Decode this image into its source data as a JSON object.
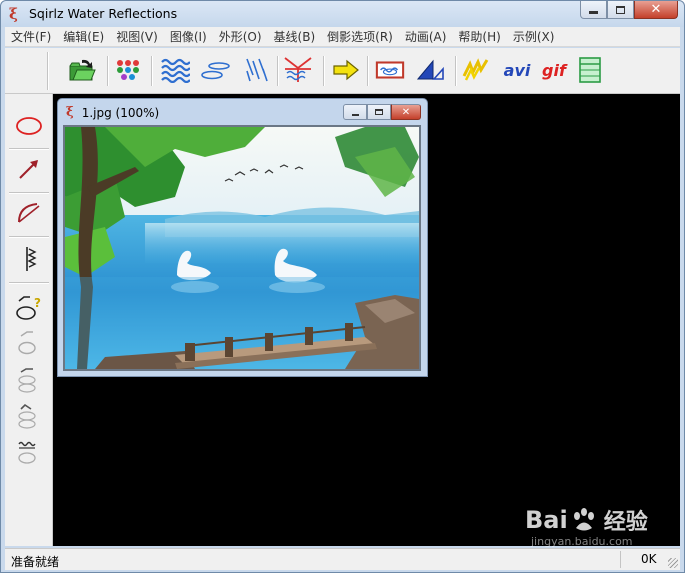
{
  "app": {
    "title": "Sqirlz Water Reflections",
    "icon_glyph": "ξ",
    "close_glyph": "✕"
  },
  "menu": [
    {
      "label": "文件(F)"
    },
    {
      "label": "编辑(E)"
    },
    {
      "label": "视图(V)"
    },
    {
      "label": "图像(I)"
    },
    {
      "label": "外形(O)"
    },
    {
      "label": "基线(B)"
    },
    {
      "label": "倒影选项(R)"
    },
    {
      "label": "动画(A)"
    },
    {
      "label": "帮助(H)"
    },
    {
      "label": "示例(X)"
    }
  ],
  "toolbar": {
    "avi_label": "avi",
    "gif_label": "gif"
  },
  "child_window": {
    "title": "1.jpg   (100%)"
  },
  "status": {
    "text": "准备就绪",
    "right": "0K"
  },
  "watermark": {
    "brand_latin": "Bai",
    "brand_cn": "经验",
    "url": "jingyan.baidu.com"
  },
  "colors": {
    "accent_blue": "#2f6fd0",
    "icon_red": "#c0392b",
    "mdi_background": "#000000"
  }
}
